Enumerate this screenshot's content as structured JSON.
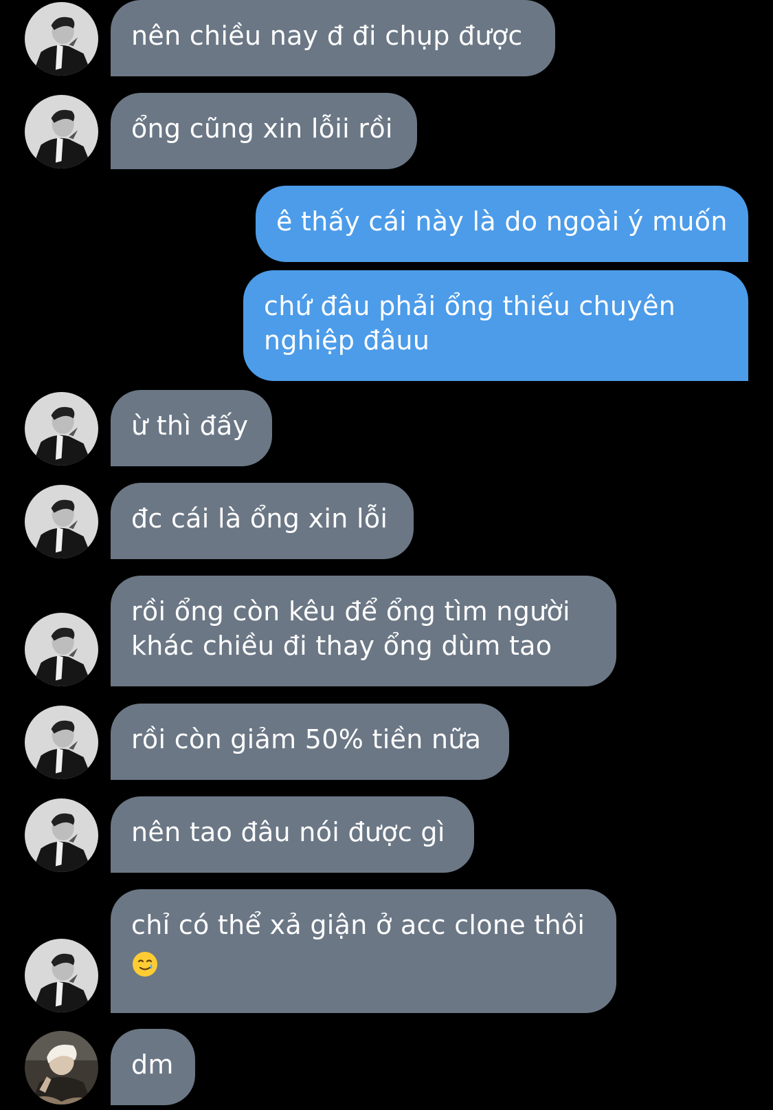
{
  "colors": {
    "background": "#000000",
    "incoming_bubble": "#6b7785",
    "outgoing_bubble": "#4c9ce9",
    "text": "#ffffff"
  },
  "messages": [
    {
      "direction": "incoming",
      "sender_avatar": "friend-bw-portrait",
      "lines": [
        "nên chiều nay đ đi chụp được"
      ]
    },
    {
      "direction": "incoming",
      "sender_avatar": "friend-bw-portrait",
      "lines": [
        "ổng cũng xin lỗii rồi"
      ]
    },
    {
      "direction": "outgoing",
      "lines": [
        "ê thấy cái này là do ngoài ý muốn"
      ]
    },
    {
      "direction": "outgoing",
      "lines": [
        "chứ đâu phải ổng thiếu chuyên",
        "nghiệp đâuu"
      ]
    },
    {
      "direction": "incoming",
      "sender_avatar": "friend-bw-portrait",
      "lines": [
        "ừ thì đấy"
      ]
    },
    {
      "direction": "incoming",
      "sender_avatar": "friend-bw-portrait",
      "lines": [
        "đc cái là ổng xin lỗi"
      ]
    },
    {
      "direction": "incoming",
      "sender_avatar": "friend-bw-portrait",
      "lines": [
        "rồi ổng còn kêu để ổng tìm người",
        "khác chiều đi thay ổng dùm tao"
      ]
    },
    {
      "direction": "incoming",
      "sender_avatar": "friend-bw-portrait",
      "lines": [
        "rồi còn giảm 50% tiền nữa"
      ]
    },
    {
      "direction": "incoming",
      "sender_avatar": "friend-bw-portrait",
      "lines": [
        "nên tao đâu nói được gì"
      ]
    },
    {
      "direction": "incoming",
      "sender_avatar": "friend-bw-portrait",
      "lines": [
        "chỉ có thể xả giận ở acc clone thôi"
      ],
      "emoji": "smiling-face-with-tear"
    },
    {
      "direction": "incoming",
      "sender_avatar": "user-photo-avatar",
      "lines": [
        "dm"
      ]
    }
  ]
}
